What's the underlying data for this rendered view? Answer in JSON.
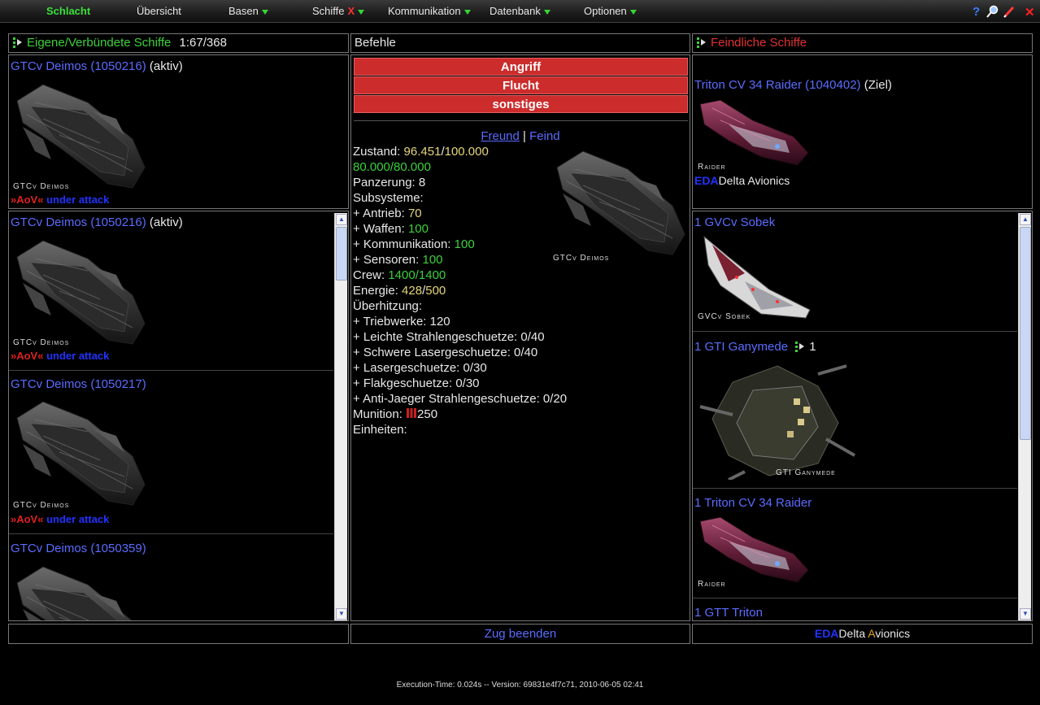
{
  "nav": {
    "items": [
      {
        "label": "Schlacht"
      },
      {
        "label": "Übersicht"
      },
      {
        "label": "Basen"
      },
      {
        "label": "Schiffe"
      },
      {
        "label": "Kommunikation"
      },
      {
        "label": "Datenbank"
      },
      {
        "label": "Optionen"
      }
    ],
    "schiffe_x": "X",
    "help": "?",
    "close": "✕"
  },
  "own": {
    "title": "Eigene/Verbündete Schiffe",
    "count": "1:67/368",
    "active_ship": {
      "name": "GTCv Deimos (1050216)",
      "status": "(aktiv)",
      "caption": "GTCv Deimos",
      "aov_tag": "»AoV«",
      "aov_text": "under attack"
    },
    "list": [
      {
        "name": "GTCv Deimos (1050216)",
        "status": "(aktiv)",
        "caption": "GTCv Deimos",
        "aov_tag": "»AoV«",
        "aov_text": "under attack"
      },
      {
        "name": "GTCv Deimos (1050217)",
        "caption": "GTCv Deimos",
        "aov_tag": "»AoV«",
        "aov_text": "under attack"
      },
      {
        "name": "GTCv Deimos (1050359)"
      }
    ]
  },
  "orders": {
    "title": "Befehle",
    "buttons": [
      "Angriff",
      "Flucht",
      "sonstiges"
    ],
    "friend": "Freund",
    "sep": "|",
    "foe": "Feind",
    "caption": "GTCv Deimos",
    "stats": {
      "zustand_label": "Zustand:",
      "zustand_cur": "96.451",
      "zustand_max": "100.000",
      "shield": "80.000/80.000",
      "panzerung": "Panzerung: 8",
      "subsysteme": "Subsysteme:",
      "antrieb_label": "+ Antrieb:",
      "antrieb": "70",
      "waffen_label": "+ Waffen:",
      "waffen": "100",
      "komm_label": "+ Kommunikation:",
      "komm": "100",
      "sensoren_label": "+ Sensoren:",
      "sensoren": "100",
      "crew_label": "Crew:",
      "crew": "1400/1400",
      "energie_label": "Energie:",
      "energie_cur": "428",
      "energie_max": "500",
      "ueberhitzung": "Überhitzung:",
      "triebwerke": "+ Triebwerke: 120",
      "leichte": "+ Leichte Strahlengeschuetze: 0/40",
      "schwere": "+ Schwere Lasergeschuetze: 0/40",
      "laser": "+ Lasergeschuetze: 0/30",
      "flak": "+ Flakgeschuetze: 0/30",
      "antijaeger": "+ Anti-Jaeger Strahlengeschuetze: 0/20",
      "munition_label": "Munition:",
      "munition": "250",
      "einheiten": "Einheiten:"
    },
    "end_turn": "Zug beenden"
  },
  "enemy": {
    "title": "Feindliche Schiffe",
    "target": {
      "name": "Triton CV 34 Raider (1040402)",
      "status": "(Ziel)",
      "caption": "Raider",
      "ally_tag": "EDA",
      "ally_name": "Delta Avionics"
    },
    "list": [
      {
        "name": "1 GVCv Sobek",
        "caption": "GVCv Sobek"
      },
      {
        "name": "1 GTI Ganymede",
        "count": "1",
        "caption": "GTI Ganymede"
      },
      {
        "name": "1 Triton CV 34 Raider",
        "caption": "Raider"
      },
      {
        "name": "1 GTT Triton"
      }
    ],
    "footer_tag": "EDA",
    "footer_d": "Delta ",
    "footer_a": "A",
    "footer_rest": "vionics"
  },
  "footer": "Execution-Time: 0.024s -- Version: 69831e4f7c71, 2010-06-05 02:41",
  "colors": {
    "accent_green": "#3bd13b",
    "action_red": "#cc2c2c",
    "link_blue": "#5a6cff",
    "enemy_red": "#e03030"
  }
}
